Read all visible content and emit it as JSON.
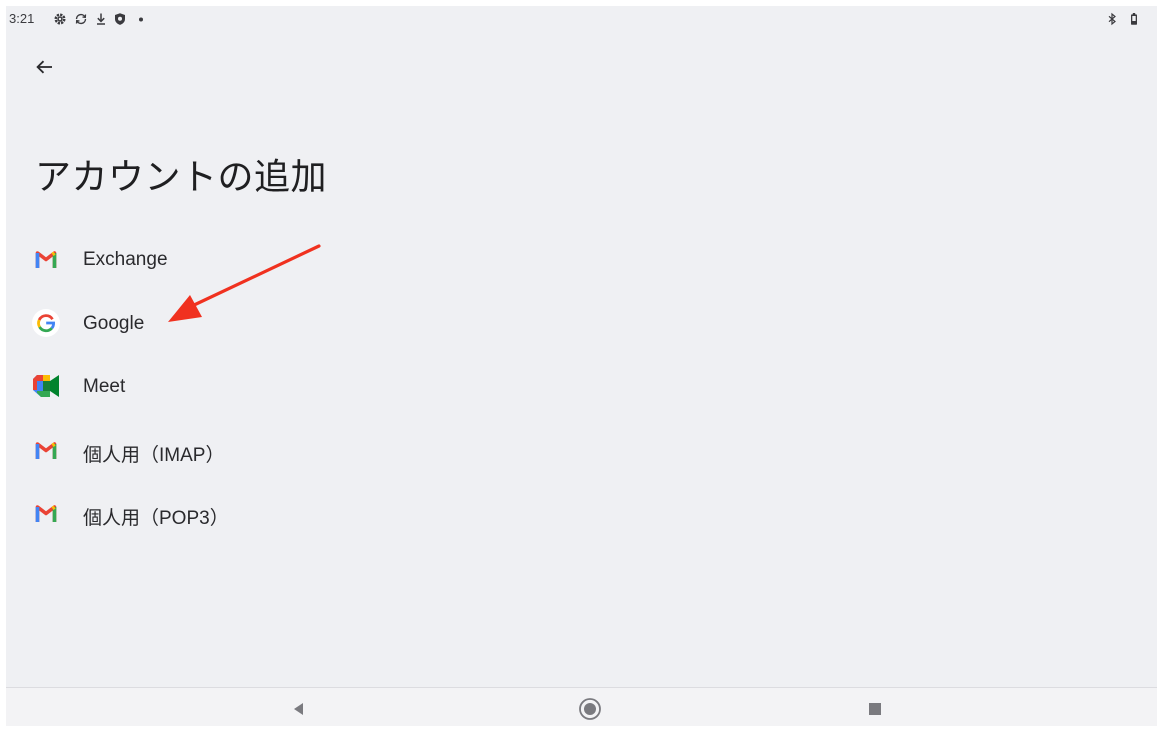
{
  "status_bar": {
    "time": "3:21",
    "left_icons": [
      "settings-icon",
      "sync-icon",
      "download-icon",
      "shield-icon",
      "dot-icon"
    ],
    "right_icons": [
      "bluetooth-icon",
      "battery-icon"
    ]
  },
  "header": {
    "back_icon": "arrow-left-icon",
    "title": "アカウントの追加"
  },
  "accounts": [
    {
      "label": "Exchange",
      "icon": "gmail-icon"
    },
    {
      "label": "Google",
      "icon": "google-icon"
    },
    {
      "label": "Meet",
      "icon": "meet-icon"
    },
    {
      "label": "個人用（IMAP）",
      "icon": "gmail-icon"
    },
    {
      "label": "個人用（POP3）",
      "icon": "gmail-icon"
    }
  ],
  "annotation": {
    "type": "red-arrow",
    "points_to": "Google",
    "color": "#f0311f"
  },
  "nav_bar": {
    "buttons": [
      "back-triangle-icon",
      "home-circle-icon",
      "recents-square-icon"
    ]
  },
  "colors": {
    "background": "#eff0f3",
    "gmail_red": "#ea4335",
    "google_blue": "#4285f4",
    "google_green": "#34a853",
    "google_yellow": "#fbbc04"
  }
}
